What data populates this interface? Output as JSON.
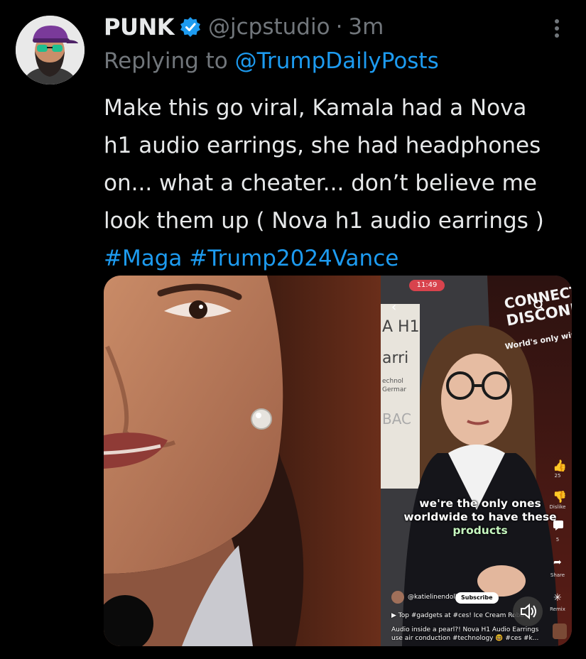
{
  "tweet": {
    "display_name": "PUNK",
    "handle": "@jcpstudio",
    "separator": "·",
    "time": "3m",
    "reply_prefix": "Replying to",
    "reply_to": "@TrumpDailyPosts",
    "body_lines": [
      "Make this go viral, Kamala had a Nova",
      "h1 audio earrings, she had headphones",
      "on... what a cheater... don’t believe me",
      "look them up ( Nova h1 audio earrings )"
    ],
    "hashtags": "#Maga #Trump2024Vance",
    "verified_icon": "verified-badge-icon",
    "more_icon": "more-vertical-icon"
  },
  "embedded_video": {
    "status_time": "11:49",
    "banner_line1": "CONNECTED",
    "banner_line2": "DISCONNI",
    "banner_tagline": "World's only wire",
    "left_sign_lines": [
      "A H1",
      "arri",
      "echnol",
      "Germar",
      "BAC"
    ],
    "caption_line1": "we're the only ones",
    "caption_line2": "worldwide to have these",
    "caption_line3": "products",
    "like_count": "25",
    "dislike_label": "Dislike",
    "comment_count": "5",
    "share_label": "Share",
    "remix_label": "Remix",
    "channel": "@katielinendoll",
    "subscribe_label": "Subscribe",
    "playlist": "Top #gadgets at #ces! Ice Cream Robo",
    "description_line1": "Audio inside a pearl?! Nova H1 Audio Earrings",
    "description_line2": "use air conduction #technology 🤓 #ces #k..."
  },
  "colors": {
    "background": "#000000",
    "text_primary": "#e7e9ea",
    "text_secondary": "#71767b",
    "link": "#1d9bf0"
  }
}
